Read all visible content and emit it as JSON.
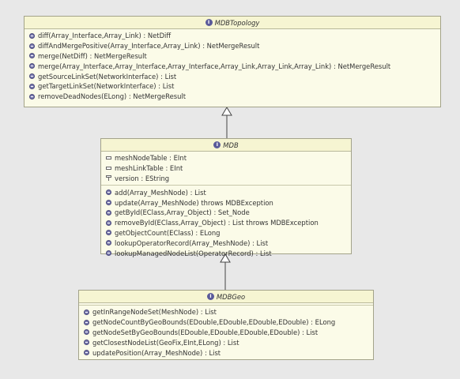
{
  "diagram": {
    "interfaces": [
      {
        "id": "mdbtopology",
        "name": "MDBTopology",
        "attributes": [],
        "operations": [
          "diff(Array_Interface,Array_Link) : NetDiff",
          "diffAndMergePositive(Array_Interface,Array_Link) : NetMergeResult",
          "merge(NetDiff) : NetMergeResult",
          "merge(Array_Interface,Array_Interface,Array_Interface,Array_Link,Array_Link,Array_Link) : NetMergeResult",
          "getSourceLinkSet(NetworkInterface) : List",
          "getTargetLinkSet(NetworkInterface) : List",
          "removeDeadNodes(ELong) : NetMergeResult"
        ]
      },
      {
        "id": "mdb",
        "name": "MDB",
        "attributes": [
          {
            "text": "meshNodeTable : EInt",
            "kind": "field"
          },
          {
            "text": "meshLinkTable : EInt",
            "kind": "field"
          },
          {
            "text": "version : EString",
            "kind": "field-volatile"
          }
        ],
        "operations": [
          "add(Array_MeshNode) : List",
          "update(Array_MeshNode) throws MDBException",
          "getById(EClass,Array_Object) : Set_Node",
          "removeById(EClass,Array_Object) : List throws MDBException",
          "getObjectCount(EClass) : ELong",
          "lookupOperatorRecord(Array_MeshNode) : List",
          "lookupManagedNodeList(OperatorRecord) : List"
        ]
      },
      {
        "id": "mdbgeo",
        "name": "MDBGeo",
        "attributes": [],
        "operations": [
          "getInRangeNodeSet(MeshNode) : List",
          "getNodeCountByGeoBounds(EDouble,EDouble,EDouble,EDouble) : ELong",
          "getNodeSetByGeoBounds(EDouble,EDouble,EDouble,EDouble) : List",
          "getClosestNodeList(GeoFix,EInt,ELong) : List",
          "updatePosition(Array_MeshNode) : List"
        ]
      }
    ],
    "generalizations": [
      {
        "from": "mdb",
        "to": "mdbtopology"
      },
      {
        "from": "mdbgeo",
        "to": "mdb"
      }
    ],
    "interface_glyph": "I",
    "icons": {
      "interface": "interface-icon",
      "operation": "operation-icon",
      "attribute": "attribute-icon"
    },
    "colors": {
      "background": "#e8e8e8",
      "box_fill": "#fbfbe8",
      "header_fill": "#f6f5d2",
      "border": "#a3a38a",
      "interface_icon": "#5a5a9a",
      "connector": "#444444"
    }
  }
}
